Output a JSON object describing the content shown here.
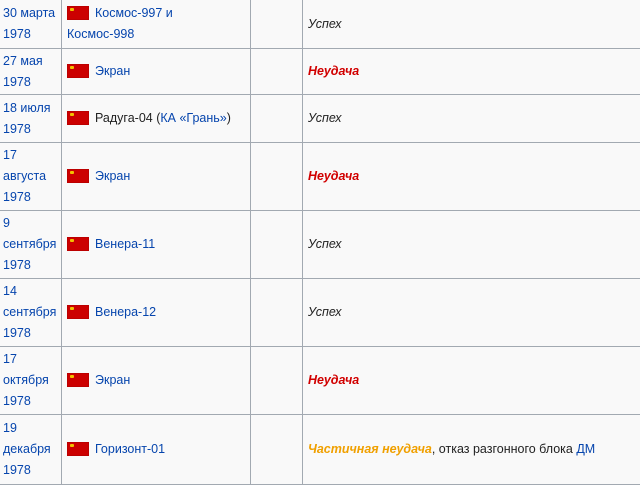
{
  "colors": {
    "link": "#0645ad",
    "failure": "#d10000",
    "partial": "#f0a000",
    "border": "#a2a9b1"
  },
  "rows": [
    {
      "date": [
        "30 марта",
        "1978"
      ],
      "satellite": [
        {
          "text": "Космос-997 и",
          "link": true
        },
        {
          "br": true
        },
        {
          "text": "Космос-998",
          "link": true
        }
      ],
      "result": "Успех",
      "result_type": "success",
      "note_prefix": "",
      "note_link": ""
    },
    {
      "date": [
        "27 мая",
        "1978"
      ],
      "satellite": [
        {
          "text": "Экран",
          "link": true
        }
      ],
      "result": "Неудача",
      "result_type": "failure",
      "note_prefix": "",
      "note_link": ""
    },
    {
      "date": [
        "18 июля",
        "1978"
      ],
      "satellite": [
        {
          "text": "Радуга-04 (",
          "link": false
        },
        {
          "text": "КА «Грань»",
          "link": true
        },
        {
          "text": ")",
          "link": false
        }
      ],
      "result": "Успех",
      "result_type": "success",
      "note_prefix": "",
      "note_link": ""
    },
    {
      "date": [
        "17",
        "августа",
        "1978"
      ],
      "satellite": [
        {
          "text": "Экран",
          "link": true
        }
      ],
      "result": "Неудача",
      "result_type": "failure",
      "note_prefix": "",
      "note_link": ""
    },
    {
      "date": [
        "9",
        "сентября",
        "1978"
      ],
      "satellite": [
        {
          "text": "Венера-11",
          "link": true
        }
      ],
      "result": "Успех",
      "result_type": "success",
      "note_prefix": "",
      "note_link": ""
    },
    {
      "date": [
        "14",
        "сентября",
        "1978"
      ],
      "satellite": [
        {
          "text": "Венера-12",
          "link": true
        }
      ],
      "result": "Успех",
      "result_type": "success",
      "note_prefix": "",
      "note_link": ""
    },
    {
      "date": [
        "17",
        "октября",
        "1978"
      ],
      "satellite": [
        {
          "text": "Экран",
          "link": true
        }
      ],
      "result": "Неудача",
      "result_type": "failure",
      "note_prefix": "",
      "note_link": ""
    },
    {
      "date": [
        "19",
        "декабря",
        "1978"
      ],
      "satellite": [
        {
          "text": "Горизонт-01",
          "link": true
        }
      ],
      "result": "Частичная неудача",
      "result_type": "partial",
      "note_prefix": ", отказ разгонного блока ",
      "note_link": "ДМ"
    }
  ]
}
